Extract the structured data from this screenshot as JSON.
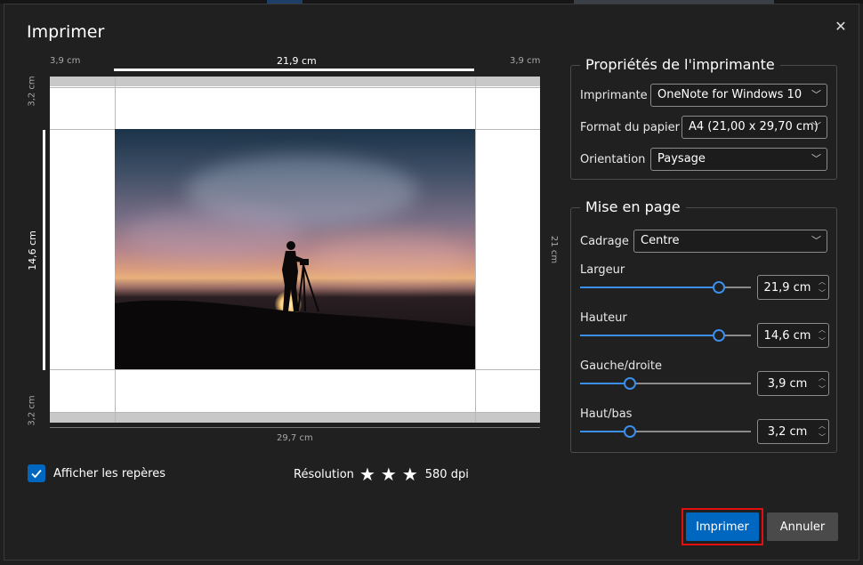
{
  "dialog": {
    "title": "Imprimer",
    "close_glyph": "✕"
  },
  "preview": {
    "ruler_top_left": "3,9 cm",
    "ruler_top_center": "21,9 cm",
    "ruler_top_right": "3,9 cm",
    "ruler_bottom": "29,7 cm",
    "ruler_left_top": "3,2 cm",
    "ruler_left_center": "14,6 cm",
    "ruler_left_bottom": "3,2 cm",
    "ruler_right": "21 cm"
  },
  "options": {
    "show_guides_label": "Afficher les repères",
    "show_guides_checked": true,
    "resolution_label": "Résolution",
    "resolution_stars": 3,
    "star_glyph": "★",
    "resolution_value": "580 dpi"
  },
  "printer_props": {
    "legend": "Propriétés de l'imprimante",
    "printer_label": "Imprimante",
    "printer_value": "OneNote for Windows 10",
    "paper_label": "Format du papier",
    "paper_value": "A4 (21,00 x 29,70 cm)",
    "orientation_label": "Orientation",
    "orientation_value": "Paysage"
  },
  "layout": {
    "legend": "Mise en page",
    "crop_label": "Cadrage",
    "crop_value": "Centre",
    "width_label": "Largeur",
    "width_value": "21,9 cm",
    "width_level": 0.81,
    "height_label": "Hauteur",
    "height_value": "14,6 cm",
    "height_level": 0.81,
    "lr_label": "Gauche/droite",
    "lr_value": "3,9 cm",
    "lr_level": 0.29,
    "tb_label": "Haut/bas",
    "tb_value": "3,2 cm",
    "tb_level": 0.29
  },
  "buttons": {
    "print": "Imprimer",
    "cancel": "Annuler"
  },
  "colors": {
    "accent": "#0067c0",
    "slider": "#3b8eea",
    "highlight": "#e01010"
  },
  "icons": {
    "chevron": "chevron-down-icon",
    "spin_up": "chevron-up-icon",
    "spin_down": "chevron-down-icon",
    "check": "checkmark-icon",
    "star": "star-icon",
    "close": "close-icon"
  }
}
